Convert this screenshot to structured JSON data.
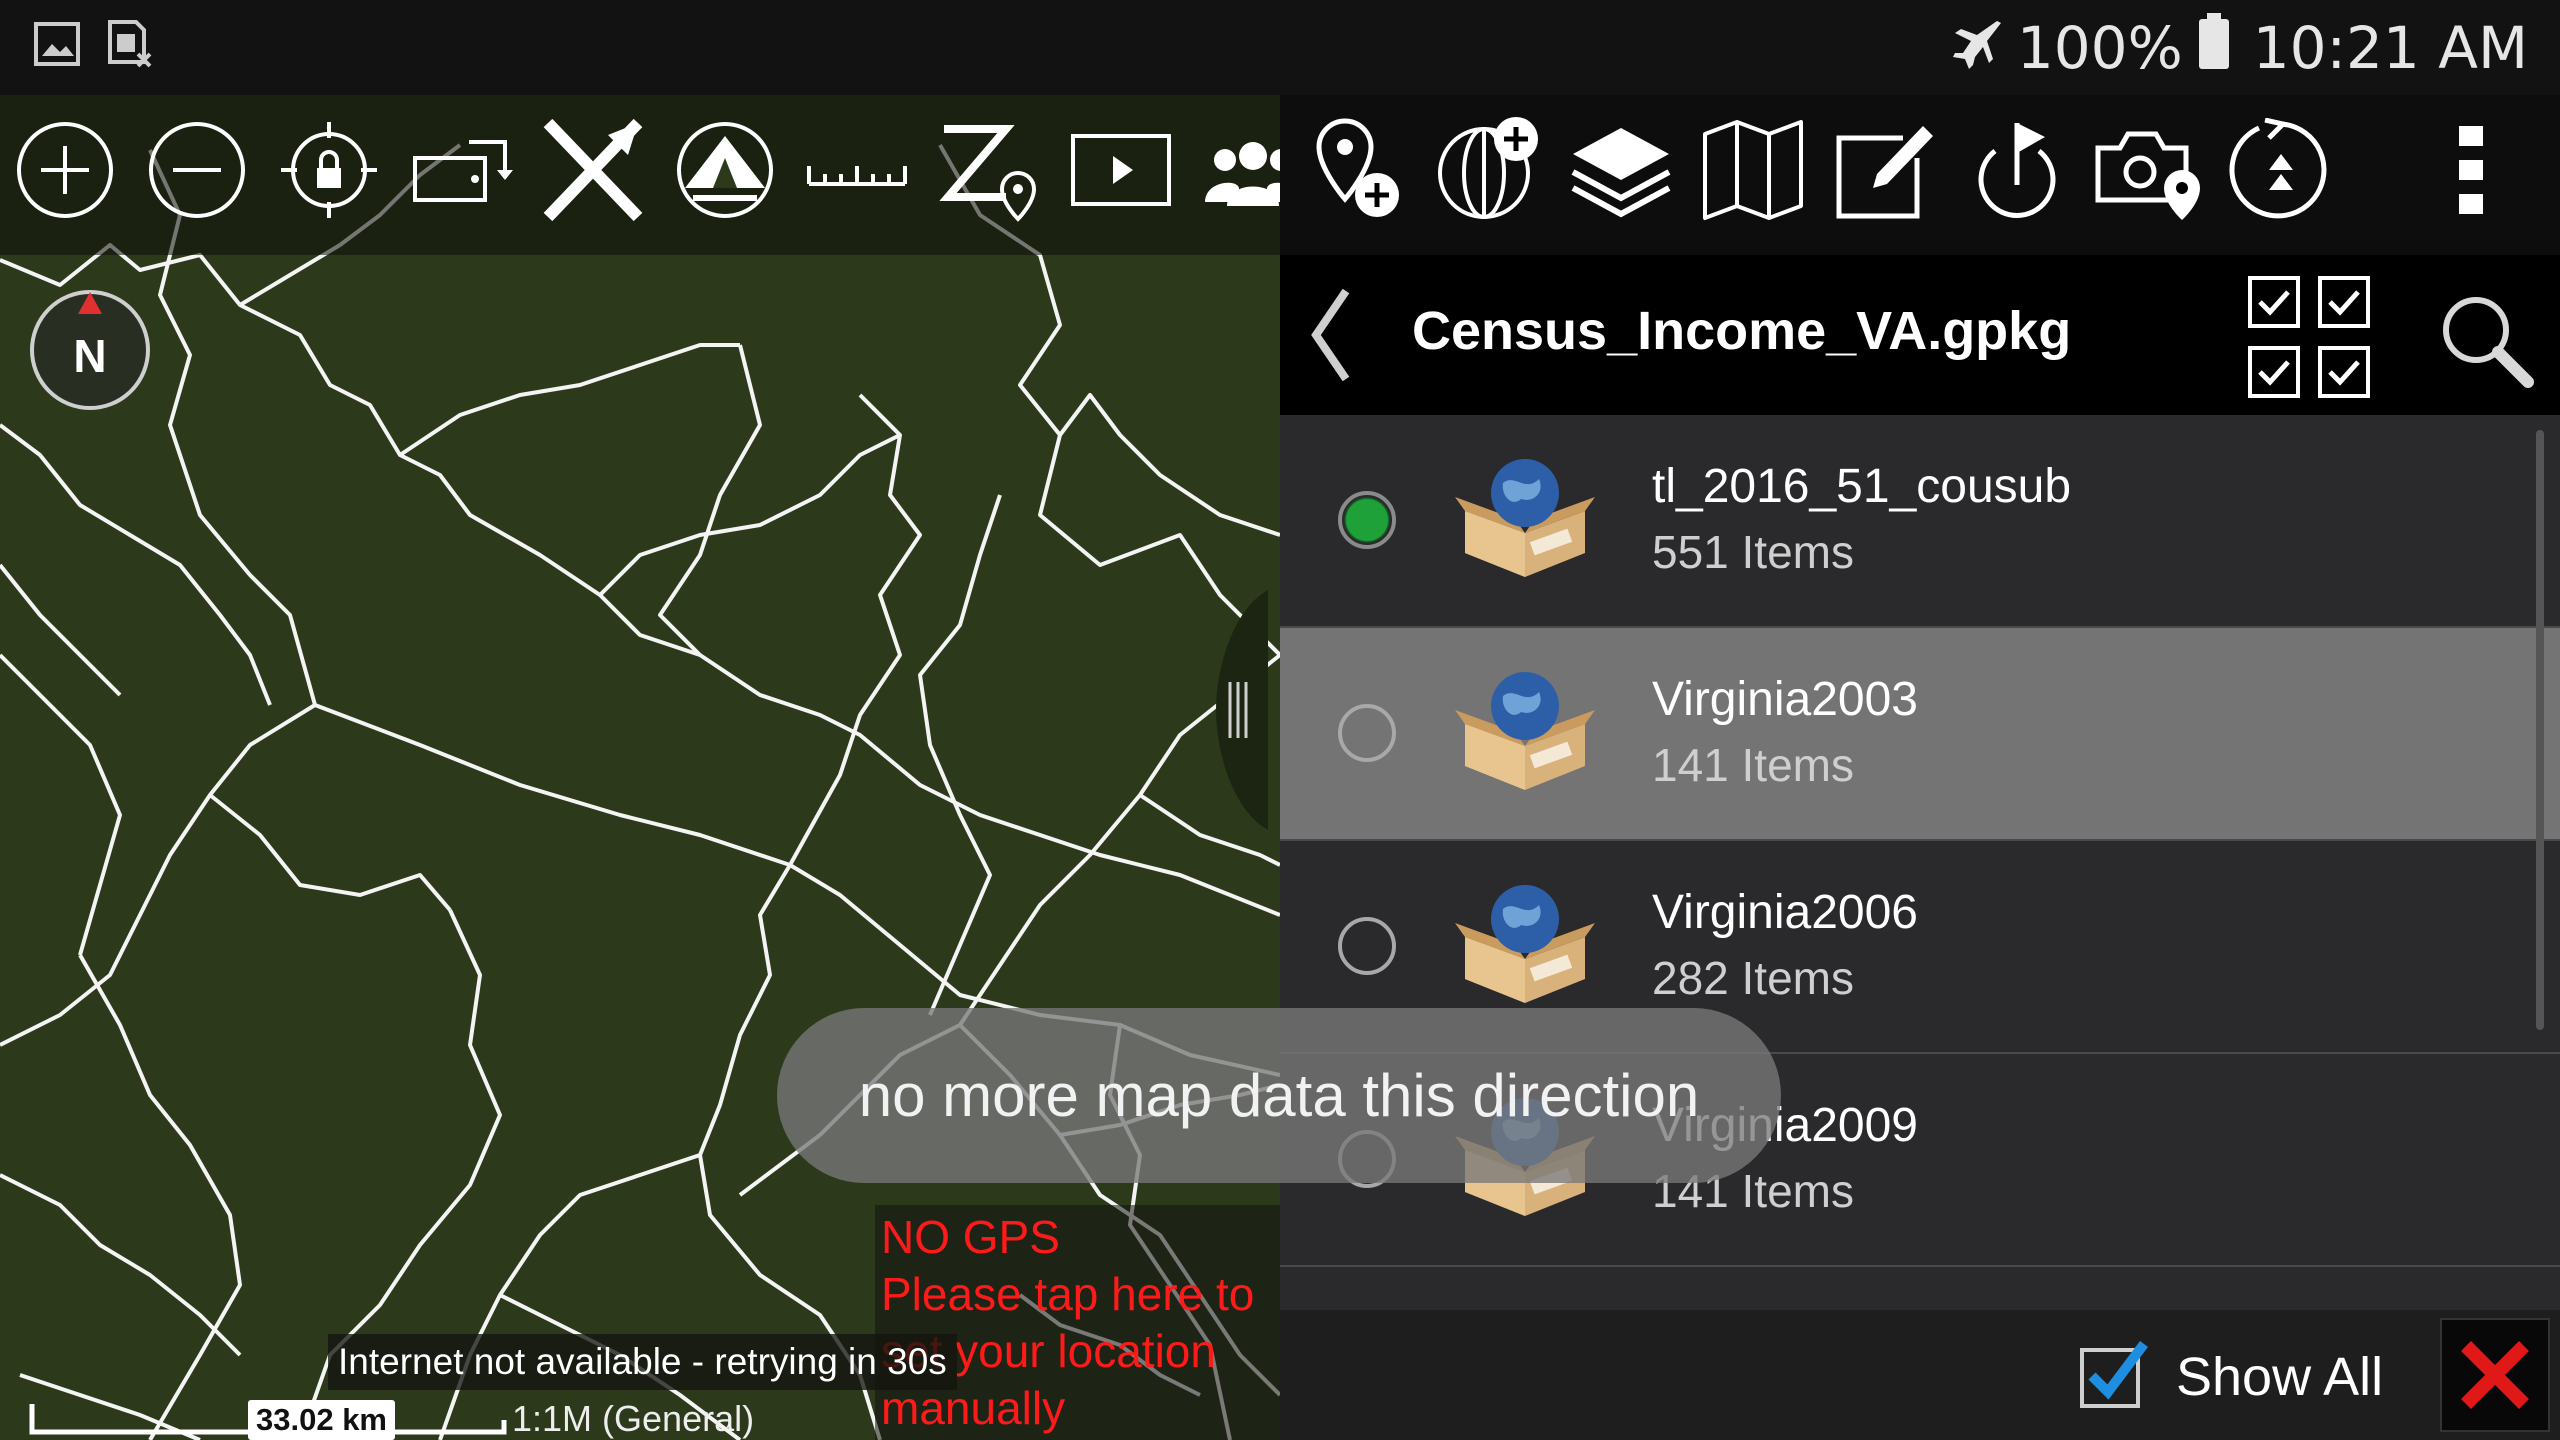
{
  "status_bar": {
    "battery": "100%",
    "time": "10:21 AM",
    "icons": [
      "image-icon",
      "sim-icon",
      "airplane-icon",
      "battery-icon"
    ]
  },
  "map": {
    "toolbar_icons": [
      "zoom-in-icon",
      "zoom-out-icon",
      "location-lock-icon",
      "rotate-screen-icon",
      "nav-arrow-icon",
      "tent-icon",
      "ruler-icon",
      "zoom-location-icon",
      "play-icon",
      "people-icon"
    ],
    "compass_label": "N",
    "no_gps": {
      "line1": "NO GPS",
      "line2": "Please tap here to",
      "line3": "set your location",
      "line4": "manually"
    },
    "internet_message": "Internet not available - retrying in 30s",
    "scale_km": "33.02 km",
    "scale_label": "1:1M (General)"
  },
  "panel": {
    "toolbar_icons": [
      "add-point-icon",
      "add-layer-globe-icon",
      "layers-icon",
      "map-icon",
      "edit-icon",
      "waypoint-icon",
      "camera-location-icon",
      "gps-tracking-icon",
      "overflow-menu-icon"
    ],
    "title": "Census_Income_VA.gpkg",
    "items": [
      {
        "name": "tl_2016_51_cousub",
        "count": "551 Items",
        "selected": true
      },
      {
        "name": "Virginia2003",
        "count": "141 Items",
        "selected": false
      },
      {
        "name": "Virginia2006",
        "count": "282 Items",
        "selected": false
      },
      {
        "name": "Virginia2009",
        "count": "141 Items",
        "selected": false
      }
    ],
    "show_all_label": "Show All"
  },
  "toast": "no more map data this direction",
  "colors": {
    "map_bg": "#2c391b",
    "selected_row": "#747474",
    "radio_on": "#1fa13a",
    "gps_warning": "#ff1a1a",
    "close": "#e01818",
    "check": "#1e8fe0"
  }
}
